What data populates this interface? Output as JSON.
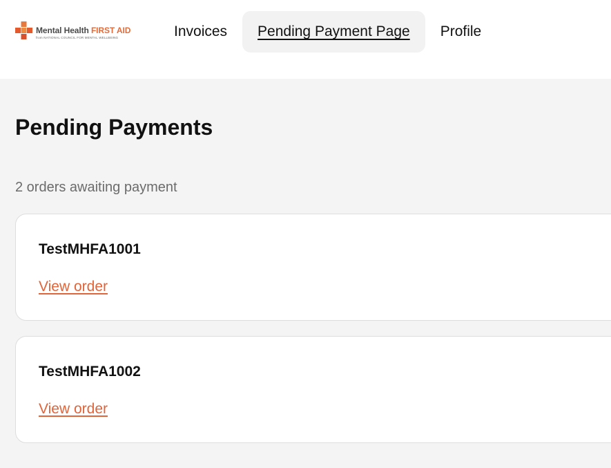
{
  "brand": {
    "name_part1": "Mental Health ",
    "name_part2": "FIRST AID",
    "tagline": "from NATIONAL COUNCIL FOR MENTAL WELLBEING",
    "accent_color": "#e46c3a",
    "logo_icon": "cross-icon"
  },
  "nav": {
    "items": [
      {
        "label": "Invoices",
        "active": false
      },
      {
        "label": "Pending Payment Page",
        "active": true
      },
      {
        "label": "Profile",
        "active": false
      }
    ]
  },
  "main": {
    "title": "Pending Payments",
    "summary": "2 orders awaiting payment",
    "orders": [
      {
        "id": "TestMHFA1001",
        "link_label": "View order"
      },
      {
        "id": "TestMHFA1002",
        "link_label": "View order"
      }
    ]
  },
  "colors": {
    "link": "#e0643a",
    "background": "#f4f4f4",
    "card": "#ffffff"
  }
}
